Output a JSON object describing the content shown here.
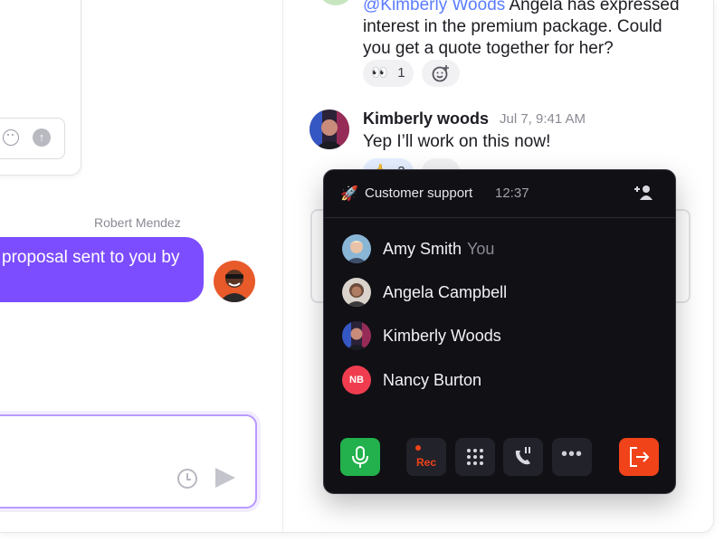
{
  "left_panel": {
    "sender_name": "Robert Mendez",
    "bubble_text": "proposal sent to you by"
  },
  "chat": {
    "prev_message_line1_mention": "@Kimberly Woods",
    "prev_message_line1_rest": " Angela has expressed",
    "prev_message_line2": "interest in the premium package. Could",
    "prev_message_line3": "you get a quote together for her?",
    "reaction_eyes_emoji": "👀",
    "reaction_eyes_count": "1",
    "kimberly_name": "Kimberly woods",
    "kimberly_time": "Jul 7, 9:41 AM",
    "kimberly_message": "Yep I’ll work on this now!",
    "reaction_thumbs_count": "2"
  },
  "call_panel": {
    "rocket_emoji": "🚀",
    "title": "Customer support",
    "duration": "12:37",
    "participants": [
      {
        "name": "Amy Smith",
        "tag": "You"
      },
      {
        "name": "Angela Campbell",
        "tag": ""
      },
      {
        "name": "Kimberly Woods",
        "tag": ""
      },
      {
        "name": "Nancy Burton",
        "tag": "",
        "initials": "NB"
      }
    ],
    "controls": {
      "rec_label": "Rec",
      "more_label": "•••"
    }
  },
  "colors": {
    "accent_purple": "#7c4dff",
    "mention_blue": "#5b7cff",
    "mic_green": "#22b14c",
    "leave_orange": "#f0431a",
    "nb_red": "#ef3d4f",
    "panel_bg": "#101015"
  },
  "icons": [
    "emoji-icon",
    "send-up-icon",
    "clock-icon",
    "send-icon",
    "add-reaction-icon",
    "add-user-icon",
    "rocket-icon",
    "mic-icon",
    "record-icon",
    "keypad-icon",
    "hold-call-icon",
    "more-icon",
    "leave-call-icon"
  ]
}
